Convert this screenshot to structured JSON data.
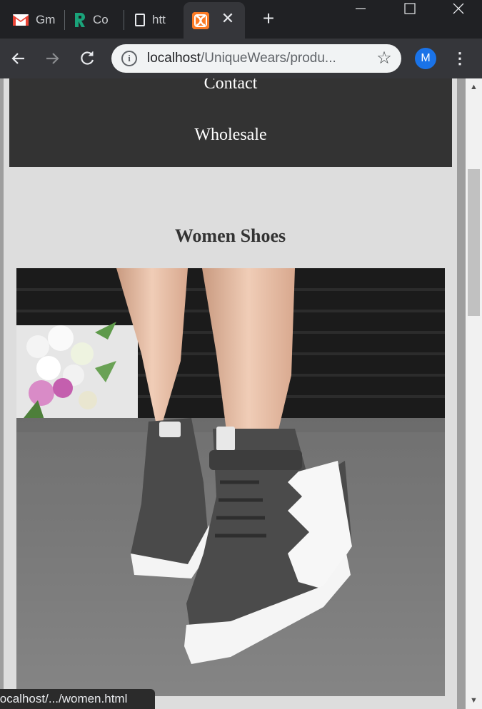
{
  "browser": {
    "tabs": [
      {
        "label": "Gm",
        "icon": "gmail-icon"
      },
      {
        "label": "Co",
        "icon": "r-logo-icon"
      },
      {
        "label": "htt",
        "icon": "document-icon"
      },
      {
        "label": "",
        "icon": "xampp-icon",
        "active": true
      }
    ],
    "close_glyph": "✕",
    "new_tab_glyph": "+",
    "omnibox": {
      "host": "localhost",
      "path": "/UniqueWears/produ..."
    },
    "profile_initial": "M",
    "status_url": "localhost/.../women.html"
  },
  "page": {
    "nav_links": [
      "Contact",
      "Wholesale"
    ],
    "section_title": "Women Shoes",
    "product_image_alt": "Women shoes"
  },
  "colors": {
    "page_bg": "#dddddd",
    "nav_bg": "#333333",
    "nav_text": "#ffffff",
    "title_text": "#333333"
  }
}
